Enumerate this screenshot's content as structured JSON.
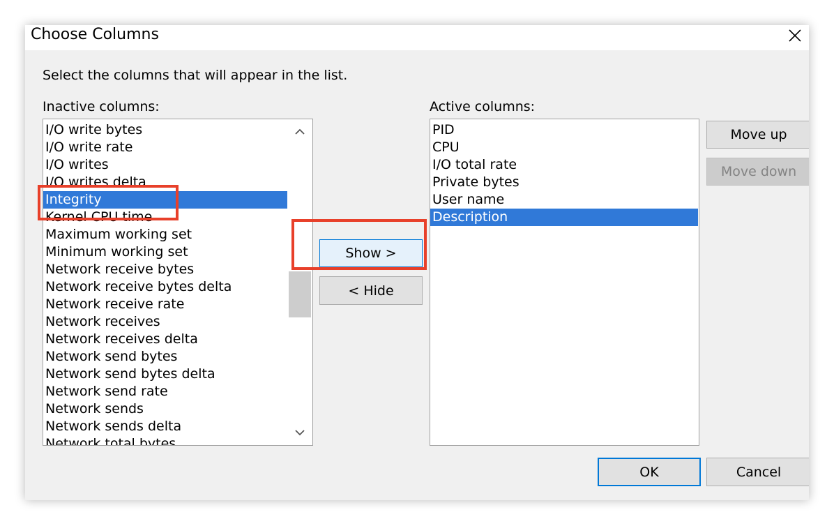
{
  "window": {
    "title": "Choose Columns",
    "close_label": "×"
  },
  "instructions": "Select the columns that will appear in the list.",
  "inactive": {
    "label": "Inactive columns:",
    "items": [
      "I/O write bytes",
      "I/O write rate",
      "I/O writes",
      "I/O writes delta",
      "Integrity",
      "Kernel CPU time",
      "Maximum working set",
      "Minimum working set",
      "Network receive bytes",
      "Network receive bytes delta",
      "Network receive rate",
      "Network receives",
      "Network receives delta",
      "Network send bytes",
      "Network send bytes delta",
      "Network send rate",
      "Network sends",
      "Network sends delta",
      "Network total bytes"
    ],
    "selected_item": "Integrity"
  },
  "active": {
    "label": "Active columns:",
    "items": [
      "PID",
      "CPU",
      "I/O total rate",
      "Private bytes",
      "User name",
      "Description"
    ],
    "selected_item": "Description"
  },
  "buttons": {
    "show": "Show >",
    "hide": "< Hide",
    "move_up": "Move up",
    "move_down": "Move down",
    "ok": "OK",
    "cancel": "Cancel"
  },
  "icons": {
    "close": "close-icon",
    "scroll_up": "chevron-up-icon",
    "scroll_down": "chevron-down-icon"
  },
  "colors": {
    "selection": "#3079d8",
    "annotation": "#e8402a",
    "focus_border": "#0078d7"
  }
}
